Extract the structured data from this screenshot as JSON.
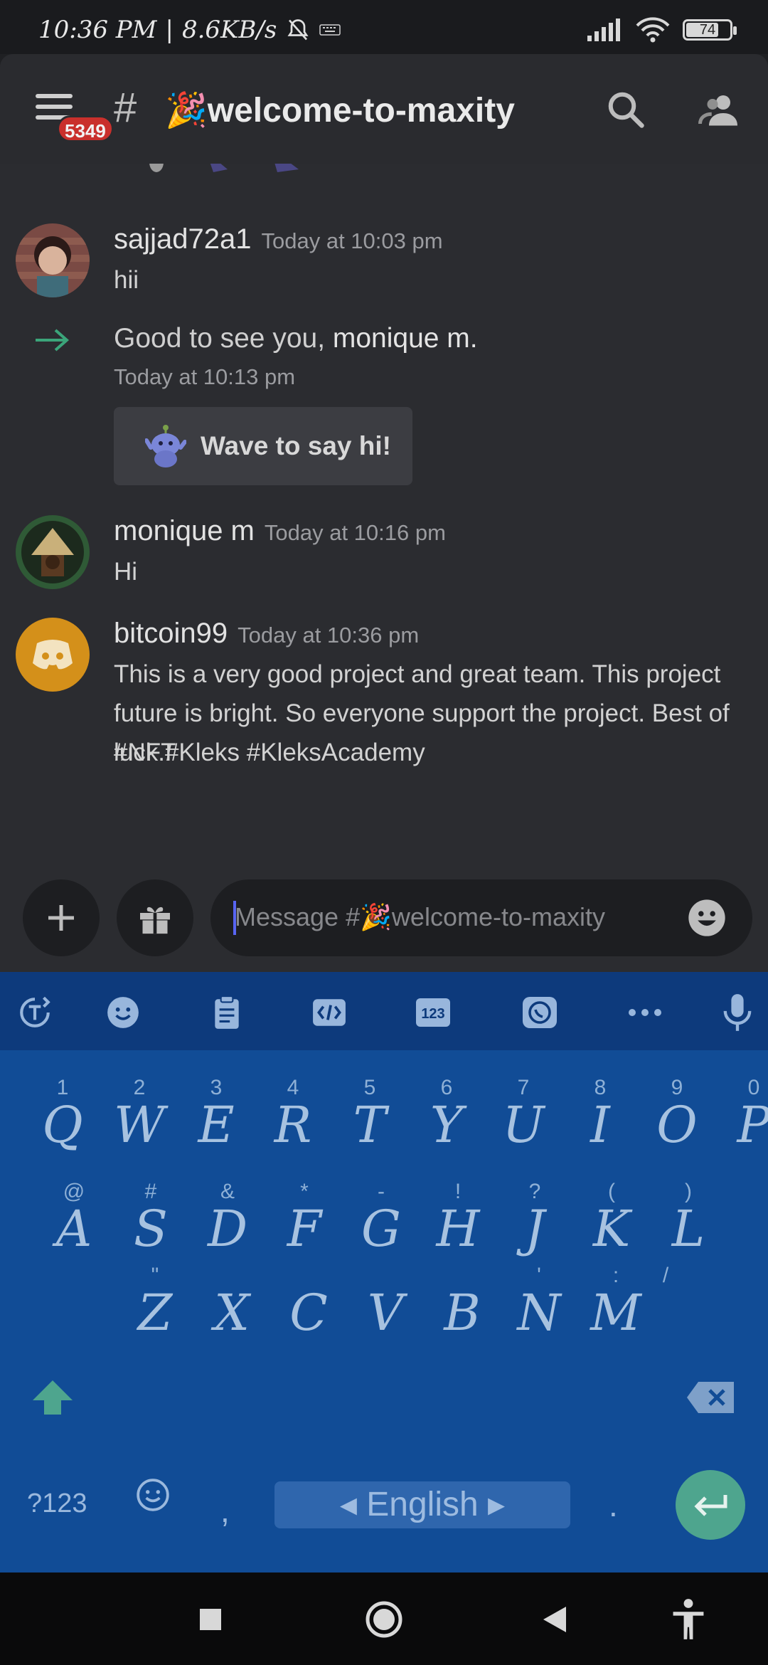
{
  "status_bar": {
    "time": "10:36 PM",
    "net_speed": "8.6KB/s",
    "battery_level": "74"
  },
  "header": {
    "unread_badge": "5349",
    "hash": "#",
    "channel_name": "🎉welcome-to-maxity"
  },
  "messages": [
    {
      "author": "sajjad72a1",
      "timestamp": "Today at 10:03 pm",
      "text": "hii"
    },
    {
      "author": "monique m",
      "timestamp": "Today at 10:16 pm",
      "text": "Hi"
    },
    {
      "author": "bitcoin99",
      "timestamp": "Today at 10:36 pm",
      "text": "This is a very good project and great team. This project future is bright. So everyone support the project. Best of luck.#Kleks #KleksAcademy",
      "text2": "#NFT"
    }
  ],
  "join_event": {
    "prefix": "Good to see you, ",
    "user": "monique m.",
    "timestamp": "Today at 10:13 pm",
    "wave_button": "Wave to say hi!"
  },
  "composer": {
    "placeholder": "Message #🎉welcome-to-maxity"
  },
  "keyboard": {
    "row1": [
      {
        "hint": "1",
        "key": "Q"
      },
      {
        "hint": "2",
        "key": "W"
      },
      {
        "hint": "3",
        "key": "E"
      },
      {
        "hint": "4",
        "key": "R"
      },
      {
        "hint": "5",
        "key": "T"
      },
      {
        "hint": "6",
        "key": "Y"
      },
      {
        "hint": "7",
        "key": "U"
      },
      {
        "hint": "8",
        "key": "I"
      },
      {
        "hint": "9",
        "key": "O"
      },
      {
        "hint": "0",
        "key": "P"
      }
    ],
    "row2": [
      {
        "hint": "@",
        "key": "A"
      },
      {
        "hint": "#",
        "key": "S"
      },
      {
        "hint": "&",
        "key": "D"
      },
      {
        "hint": "*",
        "key": "F"
      },
      {
        "hint": "-",
        "key": "G"
      },
      {
        "hint": "!",
        "key": "H"
      },
      {
        "hint": "?",
        "key": "J"
      },
      {
        "hint": "(",
        "key": "K"
      },
      {
        "hint": ")",
        "key": "L"
      }
    ],
    "row3": [
      {
        "hint": "\"",
        "key": "Z"
      },
      {
        "hint": "",
        "key": "X"
      },
      {
        "hint": "",
        "key": "C"
      },
      {
        "hint": "",
        "key": "V"
      },
      {
        "hint": "",
        "key": "B"
      },
      {
        "hint": "'",
        "key": "N"
      },
      {
        "hint": ":",
        "key": "M"
      }
    ],
    "slash_hint": "/",
    "symbols_key": "?123",
    "comma_key": ",",
    "period_key": ".",
    "language": "◂ English ▸"
  },
  "colors": {
    "background": "#2b2c30",
    "keyboard": "#114c96",
    "keyboard_toolbar": "#0d3a7c",
    "enter_key": "#4ea58e",
    "badge": "#c9302c",
    "join_arrow": "#3ba57a"
  }
}
